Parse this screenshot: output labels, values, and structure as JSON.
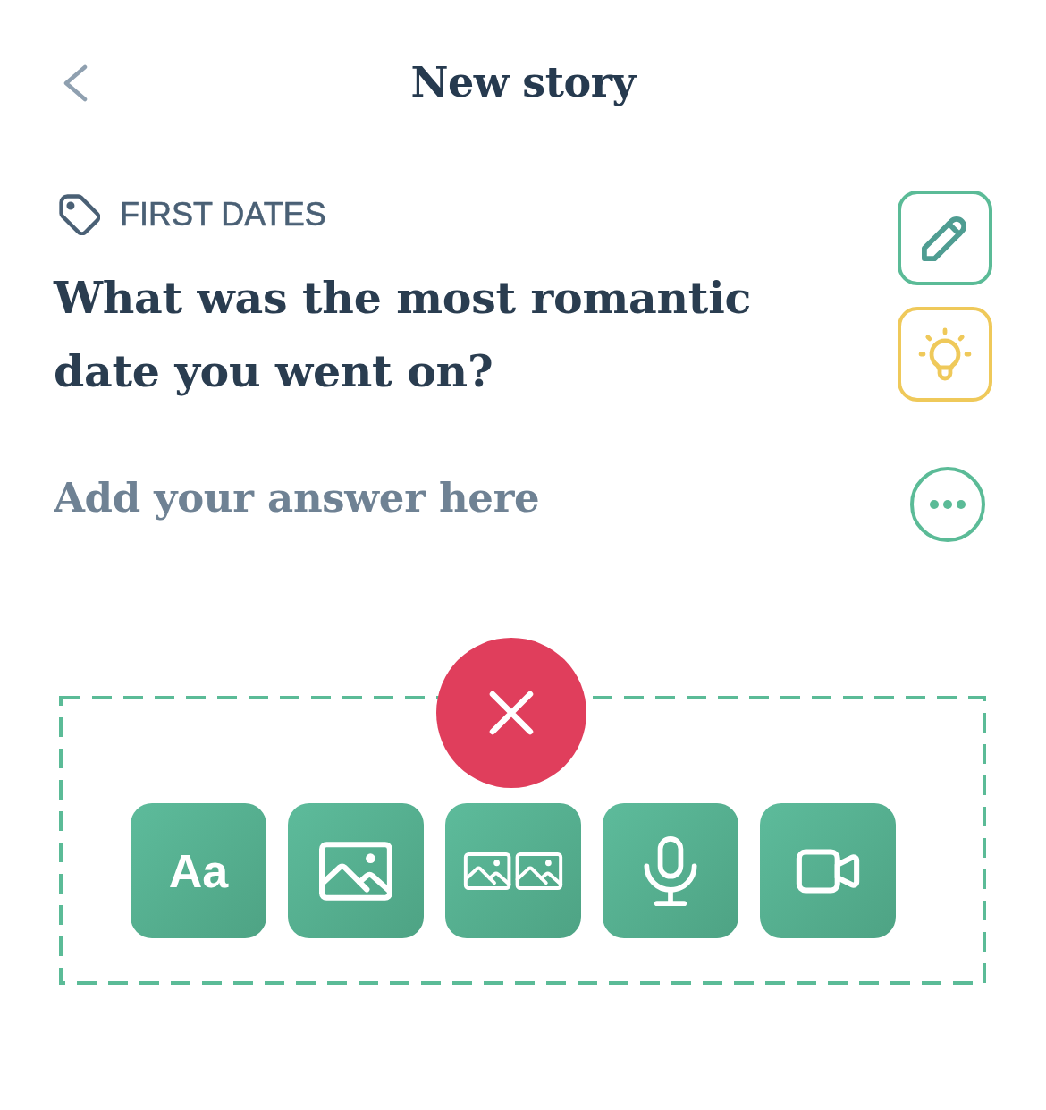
{
  "header": {
    "title": "New story"
  },
  "prompt": {
    "category": "FIRST DATES",
    "question": "What was the most romantic date you went on?",
    "actions": [
      {
        "kind": "edit",
        "color": "#5bbb97"
      },
      {
        "kind": "hint",
        "color": "#efc95a"
      }
    ]
  },
  "answer": {
    "placeholder": "Add your answer here"
  },
  "media_picker": {
    "tools": [
      {
        "kind": "text",
        "label": "Aa"
      },
      {
        "kind": "photo"
      },
      {
        "kind": "gallery"
      },
      {
        "kind": "audio"
      },
      {
        "kind": "video"
      }
    ]
  }
}
